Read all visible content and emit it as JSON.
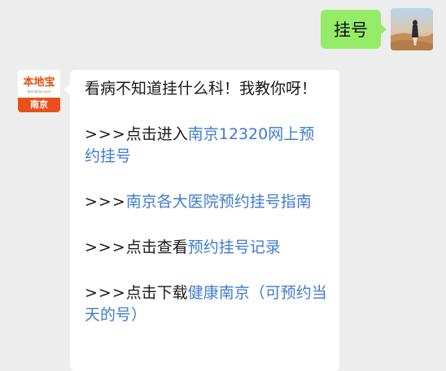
{
  "outgoing": {
    "text": "挂号"
  },
  "incoming": {
    "avatar": {
      "brand": "本地宝",
      "sub": "Bendibao.com",
      "city": "南京"
    },
    "intro": "看病不知道挂什么科！我教你呀！",
    "items": [
      {
        "prefix": ">>>",
        "action": "点击进入",
        "link": "南京12320网上预约挂号",
        "suffix": ""
      },
      {
        "prefix": ">>>",
        "action": "",
        "link": "南京各大医院预约挂号指南",
        "suffix": ""
      },
      {
        "prefix": ">>>",
        "action": "点击查看",
        "link": "预约挂号记录",
        "suffix": ""
      },
      {
        "prefix": ">>>",
        "action": "点击下载",
        "link": "健康南京",
        "suffix": "（可预约当天的号）"
      }
    ]
  },
  "colors": {
    "background": "#ededed",
    "outgoing_bubble": "#95ec69",
    "incoming_bubble": "#ffffff",
    "link": "#3f7ccf",
    "brand_orange": "#e8501a"
  }
}
